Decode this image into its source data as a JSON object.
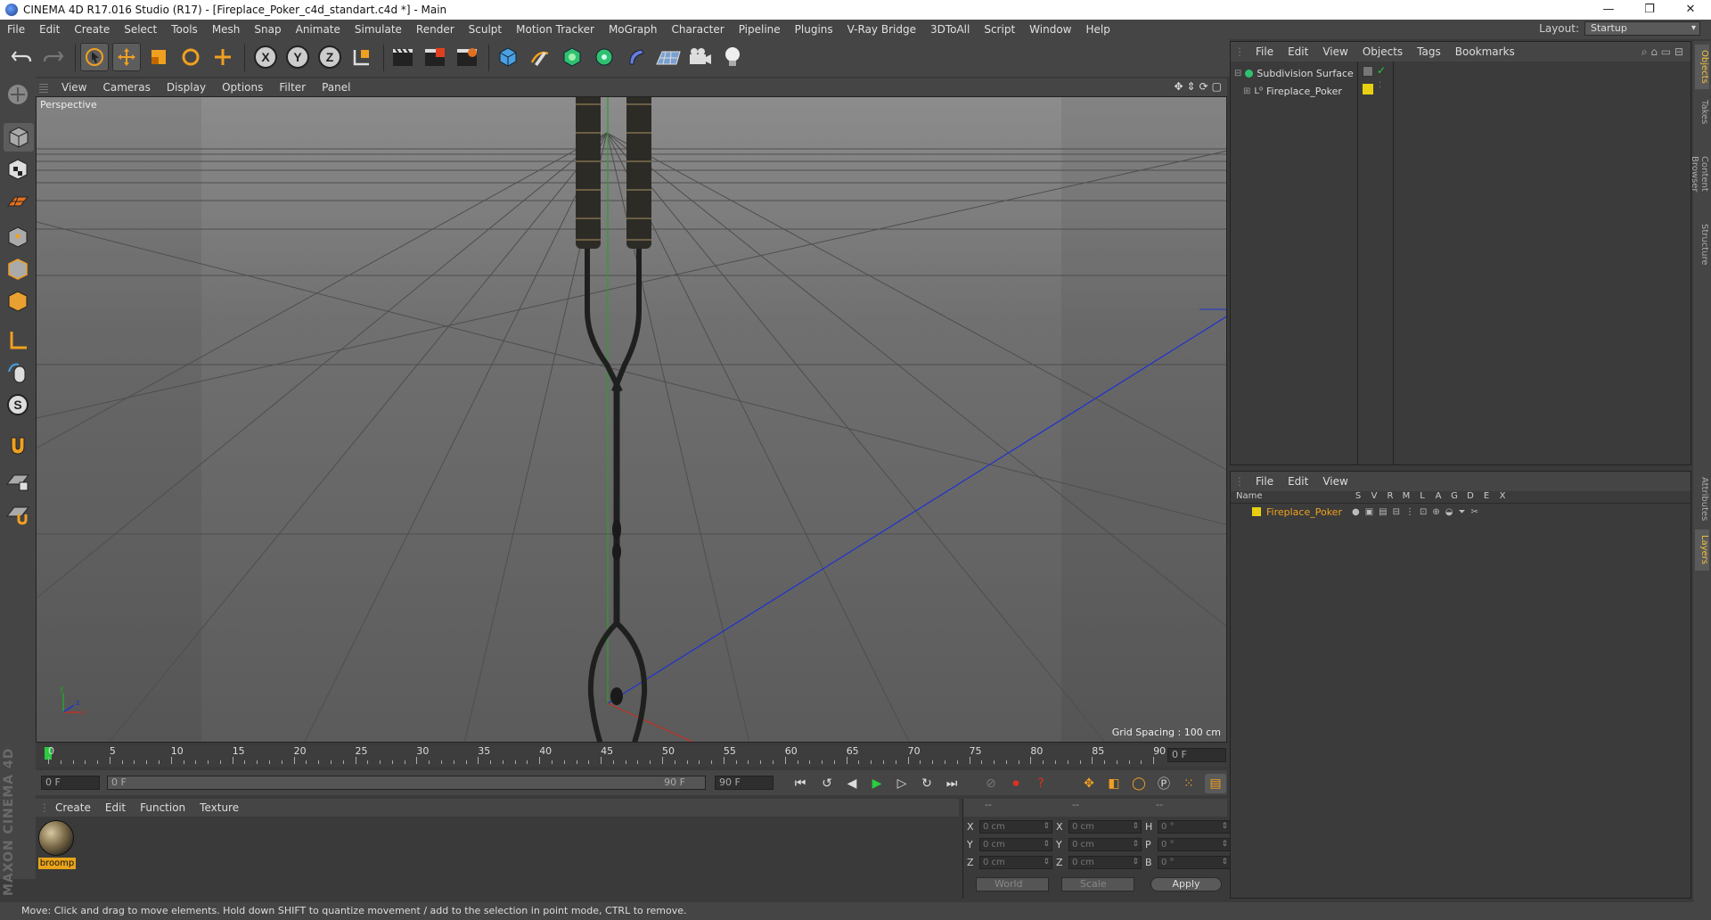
{
  "window": {
    "title": "CINEMA 4D R17.016 Studio (R17) - [Fireplace_Poker_c4d_standart.c4d *] - Main",
    "controls": [
      "—",
      "❐",
      "✕"
    ]
  },
  "menubar": {
    "items": [
      "File",
      "Edit",
      "Create",
      "Select",
      "Tools",
      "Mesh",
      "Snap",
      "Animate",
      "Simulate",
      "Render",
      "Sculpt",
      "Motion Tracker",
      "MoGraph",
      "Character",
      "Pipeline",
      "Plugins",
      "V-Ray Bridge",
      "3DToAll",
      "Script",
      "Window",
      "Help"
    ],
    "layout_label": "Layout:",
    "layout_value": "Startup"
  },
  "toolbar": {
    "axis_x": "X",
    "axis_y": "Y",
    "axis_z": "Z"
  },
  "viewport": {
    "menu": [
      "View",
      "Cameras",
      "Display",
      "Options",
      "Filter",
      "Panel"
    ],
    "camera_label": "Perspective",
    "grid_spacing": "Grid Spacing : 100 cm"
  },
  "timeline": {
    "ticks": [
      "0",
      "5",
      "10",
      "15",
      "20",
      "25",
      "30",
      "35",
      "40",
      "45",
      "50",
      "55",
      "60",
      "65",
      "70",
      "75",
      "80",
      "85",
      "90"
    ],
    "current_frame": "0 F",
    "start_field": "0 F",
    "range_start": "0 F",
    "range_end": "90 F",
    "end_field": "90 F"
  },
  "materials": {
    "menu": [
      "Create",
      "Edit",
      "Function",
      "Texture"
    ],
    "items": [
      {
        "name": "broomp"
      }
    ]
  },
  "coordinates": {
    "headers": [
      "--",
      "--",
      "--"
    ],
    "rows": [
      {
        "a": "X",
        "av": "0 cm",
        "b": "X",
        "bv": "0 cm",
        "c": "H",
        "cv": "0 °"
      },
      {
        "a": "Y",
        "av": "0 cm",
        "b": "Y",
        "bv": "0 cm",
        "c": "P",
        "cv": "0 °"
      },
      {
        "a": "Z",
        "av": "0 cm",
        "b": "Z",
        "bv": "0 cm",
        "c": "B",
        "cv": "0 °"
      }
    ],
    "space_dropdown": "World",
    "mode_dropdown": "Scale",
    "apply_label": "Apply"
  },
  "object_manager": {
    "menu": [
      "File",
      "Edit",
      "View",
      "Objects",
      "Tags",
      "Bookmarks"
    ],
    "objects": [
      {
        "name": "Subdivision Surface"
      },
      {
        "name": "Fireplace_Poker"
      }
    ]
  },
  "layer_manager": {
    "menu": [
      "File",
      "Edit",
      "View"
    ],
    "columns": [
      "Name",
      "S",
      "V",
      "R",
      "M",
      "L",
      "A",
      "G",
      "D",
      "E",
      "X"
    ],
    "layers": [
      {
        "name": "Fireplace_Poker"
      }
    ]
  },
  "side_tabs": [
    "Objects",
    "Takes",
    "Content Browser",
    "Structure",
    "Attributes",
    "Layers"
  ],
  "status": {
    "text": "Move: Click and drag to move elements. Hold down SHIFT to quantize movement / add to the selection in point mode, CTRL to remove."
  },
  "branding": {
    "text": "MAXON CINEMA 4D"
  },
  "colors": {
    "accent": "#e8a31a",
    "selection_orange": "#f0a020",
    "axis_blue": "#2233cc",
    "axis_green": "#2aa02a",
    "axis_red": "#c03020"
  }
}
